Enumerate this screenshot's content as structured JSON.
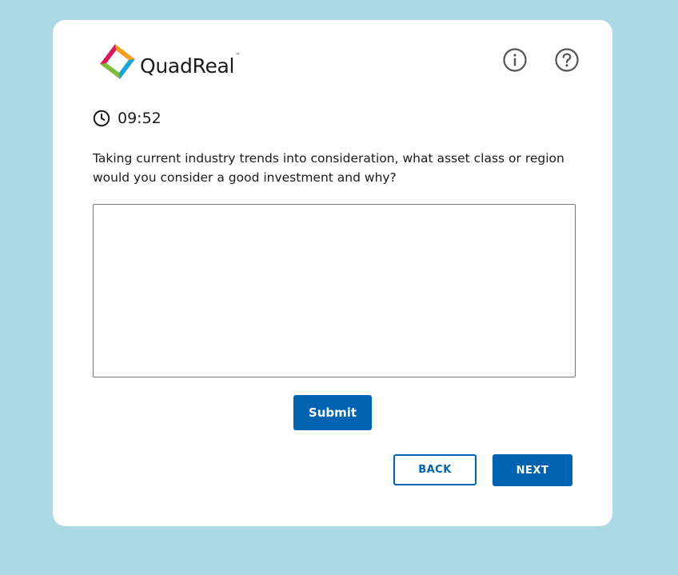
{
  "brand": {
    "name": "QuadReal",
    "trademark": "™"
  },
  "header": {
    "info_icon": "info-circle-icon",
    "help_icon": "question-circle-icon"
  },
  "timer": {
    "icon": "clock-icon",
    "value": "09:52"
  },
  "question": {
    "text": "Taking current industry trends into consideration, what asset class or region would you consider a good investment and why?"
  },
  "answer": {
    "value": "",
    "placeholder": ""
  },
  "actions": {
    "submit_label": "Submit",
    "back_label": "BACK",
    "next_label": "NEXT"
  },
  "colors": {
    "page_background": "#add8e6",
    "card_background": "#ffffff",
    "primary": "#0063b1",
    "icon_gray": "#555555"
  }
}
